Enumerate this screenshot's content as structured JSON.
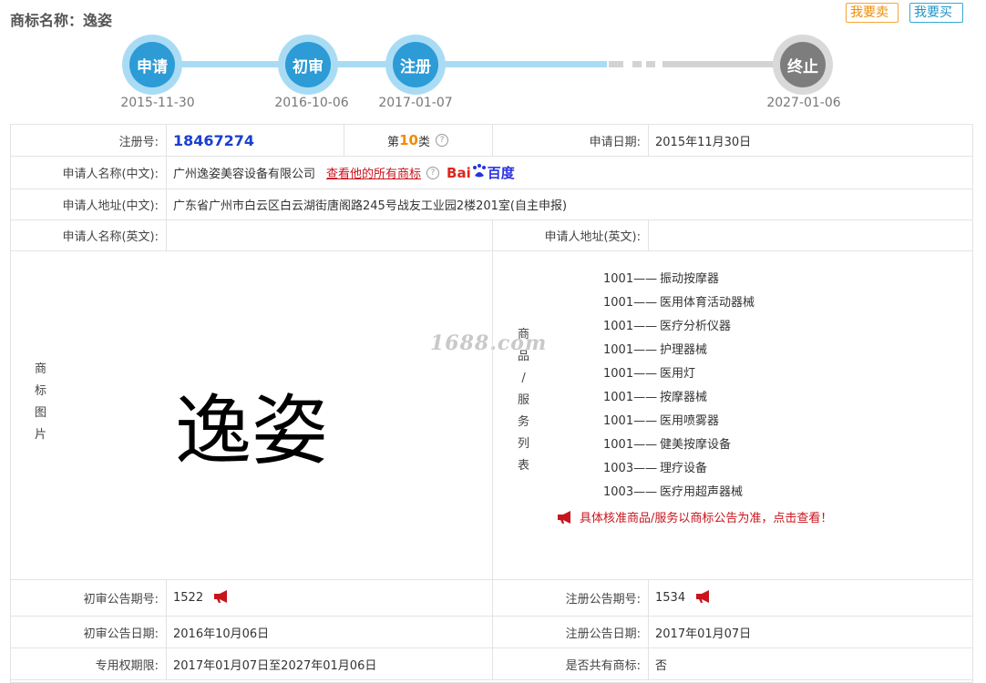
{
  "header": {
    "title": "商标名称：逸姿",
    "sell_button": "我要卖",
    "buy_button": "我要买"
  },
  "timeline": {
    "steps": [
      {
        "label": "申请",
        "date": "2015-11-30",
        "status": "done"
      },
      {
        "label": "初审",
        "date": "2016-10-06",
        "status": "done"
      },
      {
        "label": "注册",
        "date": "2017-01-07",
        "status": "done"
      },
      {
        "label": "终止",
        "date": "2027-01-06",
        "status": "pending"
      }
    ]
  },
  "info": {
    "reg_no_label": "注册号:",
    "reg_no": "18467274",
    "class_prefix": "第",
    "class_num": "10",
    "class_suffix": "类",
    "apply_date_label": "申请日期:",
    "apply_date": "2015年11月30日",
    "applicant_cn_label": "申请人名称(中文):",
    "applicant_cn": "广州逸姿美容设备有限公司",
    "view_all_link": "查看他的所有商标",
    "baidu_bai": "Bai",
    "baidu_du": "百度",
    "address_cn_label": "申请人地址(中文):",
    "address_cn": "广东省广州市白云区白云湖街唐阁路245号战友工业园2楼201室(自主申报)",
    "applicant_en_label": "申请人名称(英文):",
    "applicant_en": "",
    "address_en_label": "申请人地址(英文):",
    "address_en": "",
    "image_label": [
      "商",
      "标",
      "图",
      "片"
    ],
    "mark_text": "逸姿",
    "watermark": "1688.com",
    "goods_label": [
      "商",
      "品",
      "/",
      "服",
      "务",
      "列",
      "表"
    ],
    "goods": [
      {
        "code": "1001——",
        "name": "振动按摩器"
      },
      {
        "code": "1001——",
        "name": "医用体育活动器械"
      },
      {
        "code": "1001——",
        "name": "医疗分析仪器"
      },
      {
        "code": "1001——",
        "name": "护理器械"
      },
      {
        "code": "1001——",
        "name": "医用灯"
      },
      {
        "code": "1001——",
        "name": "按摩器械"
      },
      {
        "code": "1001——",
        "name": "医用喷雾器"
      },
      {
        "code": "1001——",
        "name": "健美按摩设备"
      },
      {
        "code": "1003——",
        "name": "理疗设备"
      },
      {
        "code": "1003——",
        "name": "医疗用超声器械"
      }
    ],
    "goods_notice": "具体核准商品/服务以商标公告为准，点击查看！",
    "prelim_no_label": "初审公告期号:",
    "prelim_no": "1522",
    "reg_pub_no_label": "注册公告期号:",
    "reg_pub_no": "1534",
    "prelim_date_label": "初审公告日期:",
    "prelim_date": "2016年10月06日",
    "reg_pub_date_label": "注册公告日期:",
    "reg_pub_date": "2017年01月07日",
    "exclusive_label": "专用权期限:",
    "exclusive": "2017年01月07日至2027年01月06日",
    "shared_label": "是否共有商标:",
    "shared": "否"
  },
  "colors": {
    "timeline_active": "#2c9bd6",
    "timeline_track": "#a9dcf4",
    "timeline_end": "#7d7d7d",
    "link_red": "#c8151d",
    "reg_no_blue": "#1a3fd0",
    "class_orange": "#f08c00"
  }
}
